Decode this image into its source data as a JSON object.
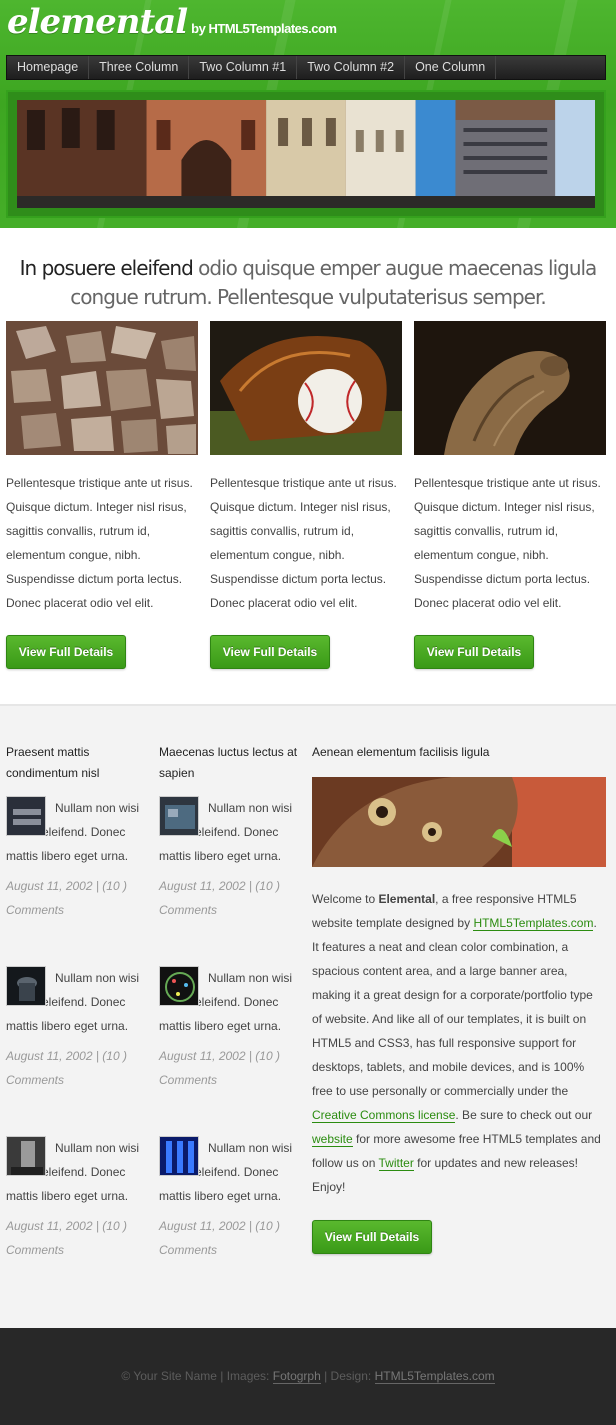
{
  "header": {
    "logo": "elemental",
    "logo_by": "by HTML5Templates.com",
    "nav": [
      "Homepage",
      "Three Column",
      "Two Column #1",
      "Two Column #2",
      "One Column"
    ]
  },
  "tagline": {
    "strong": "In posuere eleifend",
    "rest": "odio quisque emper augue maecenas ligula congue rutrum. Pellentesque vulputaterisus semper."
  },
  "features": [
    {
      "text": "Pellentesque tristique ante ut risus. Quisque dictum. Integer nisl risus, sagittis convallis, rutrum id, elementum congue, nibh. Suspendisse dictum porta lectus. Donec placerat odio vel elit.",
      "button": "View Full Details"
    },
    {
      "text": "Pellentesque tristique ante ut risus. Quisque dictum. Integer nisl risus, sagittis convallis, rutrum id, elementum congue, nibh. Suspendisse dictum porta lectus. Donec placerat odio vel elit.",
      "button": "View Full Details"
    },
    {
      "text": "Pellentesque tristique ante ut risus. Quisque dictum. Integer nisl risus, sagittis convallis, rutrum id, elementum congue, nibh. Suspendisse dictum porta lectus. Donec placerat odio vel elit.",
      "button": "View Full Details"
    }
  ],
  "columns": [
    {
      "heading": "Praesent mattis condimentum nisl",
      "posts": [
        {
          "text": "Nullam non wisi a sem eleifend. Donec mattis libero eget urna.",
          "meta": "August 11, 2002 | (10 ) Comments"
        },
        {
          "text": "Nullam non wisi a sem eleifend. Donec mattis libero eget urna.",
          "meta": "August 11, 2002 | (10 ) Comments"
        },
        {
          "text": "Nullam non wisi a sem eleifend. Donec mattis libero eget urna.",
          "meta": "August 11, 2002 | (10 ) Comments"
        }
      ]
    },
    {
      "heading": "Maecenas luctus lectus at sapien",
      "posts": [
        {
          "text": "Nullam non wisi a sem eleifend. Donec mattis libero eget urna.",
          "meta": "August 11, 2002 | (10 ) Comments"
        },
        {
          "text": "Nullam non wisi a sem eleifend. Donec mattis libero eget urna.",
          "meta": "August 11, 2002 | (10 ) Comments"
        },
        {
          "text": "Nullam non wisi a sem eleifend. Donec mattis libero eget urna.",
          "meta": "August 11, 2002 | (10 ) Comments"
        }
      ]
    }
  ],
  "about": {
    "heading": "Aenean elementum facilisis ligula",
    "p1": "Welcome to ",
    "p_bold": "Elemental",
    "p2": ", a free responsive HTML5 website template designed by ",
    "link1": "HTML5Templates.com",
    "p3": ". It features a neat and clean color combination, a spacious content area, and a large banner area, making it a great design for a corporate/portfolio type of website. And like all of our templates, it is built on HTML5 and CSS3, has full responsive support for desktops, tablets, and mobile devices, and is 100% free to use personally or commercially under the ",
    "link2": "Creative Commons license",
    "p4": ". Be sure to check out our ",
    "link3": "website",
    "p5": " for more awesome free HTML5 templates and follow us on ",
    "link4": "Twitter",
    "p6": " for updates and new releases! Enjoy!",
    "button": "View Full Details"
  },
  "footer": {
    "t1": "© Your Site Name | Images: ",
    "link1": "Fotogrph",
    "t2": " | Design: ",
    "link2": "HTML5Templates.com"
  }
}
